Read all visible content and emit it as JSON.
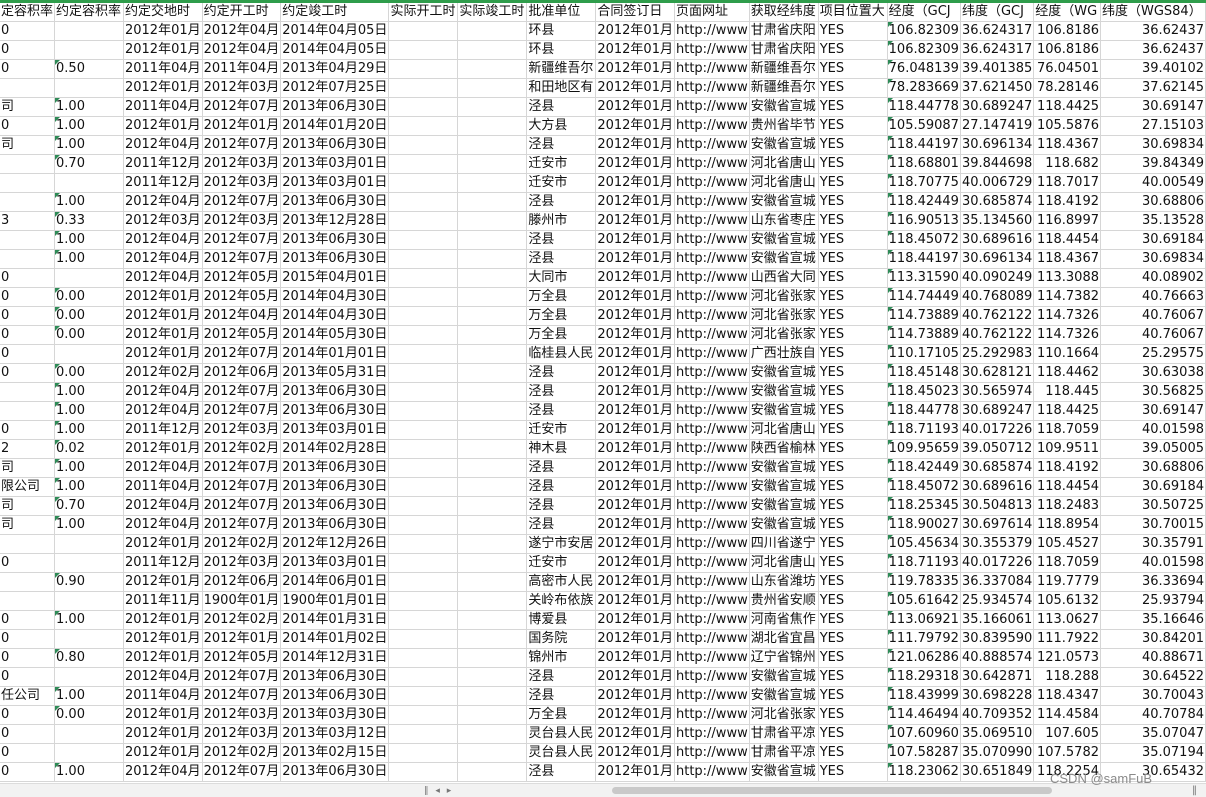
{
  "columns": [
    "定容积率",
    "约定容积率",
    "约定交地时",
    "约定开工时",
    "约定竣工时",
    "实际开工时",
    "实际竣工时",
    "批准单位",
    "合同签订日",
    "页面网址",
    "获取经纬度",
    "项目位置大",
    "经度（GCJ",
    "纬度（GCJ",
    "经度（WG",
    "纬度（WGS84）"
  ],
  "rows": [
    [
      "0",
      "",
      "2012年01月",
      "2012年04月",
      "2014年04月05日",
      "",
      "",
      "环县",
      "2012年01月",
      "http://www",
      "甘肃省庆阳",
      "YES",
      "106.82309",
      "36.624317",
      "106.8186",
      "36.62437"
    ],
    [
      "0",
      "",
      "2012年01月",
      "2012年04月",
      "2014年04月05日",
      "",
      "",
      "环县",
      "2012年01月",
      "http://www",
      "甘肃省庆阳",
      "YES",
      "106.82309",
      "36.624317",
      "106.8186",
      "36.62437"
    ],
    [
      "0",
      "0.50",
      "2011年04月",
      "2011年04月",
      "2013年04月29日",
      "",
      "",
      "新疆维吾尔",
      "2012年01月",
      "http://www",
      "新疆维吾尔",
      "YES",
      "76.048139",
      "39.401385",
      "76.04501",
      "39.40102"
    ],
    [
      "",
      "",
      "2012年01月",
      "2012年03月",
      "2012年07月25日",
      "",
      "",
      "和田地区有",
      "2012年01月",
      "http://www",
      "新疆维吾尔",
      "YES",
      "78.283669",
      "37.621450",
      "78.28146",
      "37.62145"
    ],
    [
      "司",
      "1.00",
      "2011年04月",
      "2012年07月",
      "2013年06月30日",
      "",
      "",
      "泾县",
      "2012年01月",
      "http://www",
      "安徽省宣城",
      "YES",
      "118.44778",
      "30.689247",
      "118.4425",
      "30.69147"
    ],
    [
      "0",
      "1.00",
      "2012年01月",
      "2012年01月",
      "2014年01月20日",
      "",
      "",
      "大方县",
      "2012年01月",
      "http://www",
      "贵州省毕节",
      "YES",
      "105.59087",
      "27.147419",
      "105.5876",
      "27.15103"
    ],
    [
      "司",
      "1.00",
      "2012年04月",
      "2012年07月",
      "2013年06月30日",
      "",
      "",
      "泾县",
      "2012年01月",
      "http://www",
      "安徽省宣城",
      "YES",
      "118.44197",
      "30.696134",
      "118.4367",
      "30.69834"
    ],
    [
      "",
      "0.70",
      "2011年12月",
      "2012年03月",
      "2013年03月01日",
      "",
      "",
      "迁安市",
      "2012年01月",
      "http://www",
      "河北省唐山",
      "YES",
      "118.68801",
      "39.844698",
      "118.682",
      "39.84349"
    ],
    [
      "",
      "",
      "2011年12月",
      "2012年03月",
      "2013年03月01日",
      "",
      "",
      "迁安市",
      "2012年01月",
      "http://www",
      "河北省唐山",
      "YES",
      "118.70775",
      "40.006729",
      "118.7017",
      "40.00549"
    ],
    [
      "",
      "1.00",
      "2012年04月",
      "2012年07月",
      "2013年06月30日",
      "",
      "",
      "泾县",
      "2012年01月",
      "http://www",
      "安徽省宣城",
      "YES",
      "118.42449",
      "30.685874",
      "118.4192",
      "30.68806"
    ],
    [
      "3",
      "0.33",
      "2012年03月",
      "2012年03月",
      "2013年12月28日",
      "",
      "",
      "滕州市",
      "2012年01月",
      "http://www",
      "山东省枣庄",
      "YES",
      "116.90513",
      "35.134560",
      "116.8997",
      "35.13528"
    ],
    [
      "",
      "1.00",
      "2012年04月",
      "2012年07月",
      "2013年06月30日",
      "",
      "",
      "泾县",
      "2012年01月",
      "http://www",
      "安徽省宣城",
      "YES",
      "118.45072",
      "30.689616",
      "118.4454",
      "30.69184"
    ],
    [
      "",
      "1.00",
      "2012年04月",
      "2012年07月",
      "2013年06月30日",
      "",
      "",
      "泾县",
      "2012年01月",
      "http://www",
      "安徽省宣城",
      "YES",
      "118.44197",
      "30.696134",
      "118.4367",
      "30.69834"
    ],
    [
      "0",
      "",
      "2012年04月",
      "2012年05月",
      "2015年04月01日",
      "",
      "",
      "大同市",
      "2012年01月",
      "http://www",
      "山西省大同",
      "YES",
      "113.31590",
      "40.090249",
      "113.3088",
      "40.08902"
    ],
    [
      "0",
      "0.00",
      "2012年01月",
      "2012年05月",
      "2014年04月30日",
      "",
      "",
      "万全县",
      "2012年01月",
      "http://www",
      "河北省张家",
      "YES",
      "114.74449",
      "40.768089",
      "114.7382",
      "40.76663"
    ],
    [
      "0",
      "0.00",
      "2012年01月",
      "2012年04月",
      "2014年04月30日",
      "",
      "",
      "万全县",
      "2012年01月",
      "http://www",
      "河北省张家",
      "YES",
      "114.73889",
      "40.762122",
      "114.7326",
      "40.76067"
    ],
    [
      "0",
      "0.00",
      "2012年01月",
      "2012年05月",
      "2014年05月30日",
      "",
      "",
      "万全县",
      "2012年01月",
      "http://www",
      "河北省张家",
      "YES",
      "114.73889",
      "40.762122",
      "114.7326",
      "40.76067"
    ],
    [
      "0",
      "",
      "2012年01月",
      "2012年07月",
      "2014年01月01日",
      "",
      "",
      "临桂县人民",
      "2012年01月",
      "http://www",
      "广西壮族自",
      "YES",
      "110.17105",
      "25.292983",
      "110.1664",
      "25.29575"
    ],
    [
      "0",
      "0.00",
      "2012年02月",
      "2012年06月",
      "2013年05月31日",
      "",
      "",
      "泾县",
      "2012年01月",
      "http://www",
      "安徽省宣城",
      "YES",
      "118.45148",
      "30.628121",
      "118.4462",
      "30.63038"
    ],
    [
      "",
      "1.00",
      "2012年04月",
      "2012年07月",
      "2013年06月30日",
      "",
      "",
      "泾县",
      "2012年01月",
      "http://www",
      "安徽省宣城",
      "YES",
      "118.45023",
      "30.565974",
      "118.445",
      "30.56825"
    ],
    [
      "",
      "1.00",
      "2012年04月",
      "2012年07月",
      "2013年06月30日",
      "",
      "",
      "泾县",
      "2012年01月",
      "http://www",
      "安徽省宣城",
      "YES",
      "118.44778",
      "30.689247",
      "118.4425",
      "30.69147"
    ],
    [
      "0",
      "1.00",
      "2011年12月",
      "2012年03月",
      "2013年03月01日",
      "",
      "",
      "迁安市",
      "2012年01月",
      "http://www",
      "河北省唐山",
      "YES",
      "118.71193",
      "40.017226",
      "118.7059",
      "40.01598"
    ],
    [
      "2",
      "0.02",
      "2012年01月",
      "2012年02月",
      "2014年02月28日",
      "",
      "",
      "神木县",
      "2012年01月",
      "http://www",
      "陕西省榆林",
      "YES",
      "109.95659",
      "39.050712",
      "109.9511",
      "39.05005"
    ],
    [
      "司",
      "1.00",
      "2012年04月",
      "2012年07月",
      "2013年06月30日",
      "",
      "",
      "泾县",
      "2012年01月",
      "http://www",
      "安徽省宣城",
      "YES",
      "118.42449",
      "30.685874",
      "118.4192",
      "30.68806"
    ],
    [
      "限公司",
      "1.00",
      "2011年04月",
      "2012年07月",
      "2013年06月30日",
      "",
      "",
      "泾县",
      "2012年01月",
      "http://www",
      "安徽省宣城",
      "YES",
      "118.45072",
      "30.689616",
      "118.4454",
      "30.69184"
    ],
    [
      "司",
      "0.70",
      "2012年04月",
      "2012年07月",
      "2013年06月30日",
      "",
      "",
      "泾县",
      "2012年01月",
      "http://www",
      "安徽省宣城",
      "YES",
      "118.25345",
      "30.504813",
      "118.2483",
      "30.50725"
    ],
    [
      "司",
      "1.00",
      "2012年04月",
      "2012年07月",
      "2013年06月30日",
      "",
      "",
      "泾县",
      "2012年01月",
      "http://www",
      "安徽省宣城",
      "YES",
      "118.90027",
      "30.697614",
      "118.8954",
      "30.70015"
    ],
    [
      "",
      "",
      "2012年01月",
      "2012年02月",
      "2012年12月26日",
      "",
      "",
      "遂宁市安居",
      "2012年01月",
      "http://www",
      "四川省遂宁",
      "YES",
      "105.45634",
      "30.355379",
      "105.4527",
      "30.35791"
    ],
    [
      "0",
      "",
      "2011年12月",
      "2012年03月",
      "2013年03月01日",
      "",
      "",
      "迁安市",
      "2012年01月",
      "http://www",
      "河北省唐山",
      "YES",
      "118.71193",
      "40.017226",
      "118.7059",
      "40.01598"
    ],
    [
      "",
      "0.90",
      "2012年01月",
      "2012年06月",
      "2014年06月01日",
      "",
      "",
      "高密市人民",
      "2012年01月",
      "http://www",
      "山东省潍坊",
      "YES",
      "119.78335",
      "36.337084",
      "119.7779",
      "36.33694"
    ],
    [
      "",
      "",
      "2011年11月",
      "1900年01月",
      "1900年01月01日",
      "",
      "",
      "关岭布依族",
      "2012年01月",
      "http://www",
      "贵州省安顺",
      "YES",
      "105.61642",
      "25.934574",
      "105.6132",
      "25.93794"
    ],
    [
      "0",
      "1.00",
      "2012年01月",
      "2012年02月",
      "2014年01月31日",
      "",
      "",
      "博爱县",
      "2012年01月",
      "http://www",
      "河南省焦作",
      "YES",
      "113.06921",
      "35.166061",
      "113.0627",
      "35.16646"
    ],
    [
      "0",
      "",
      "2012年01月",
      "2012年01月",
      "2014年01月02日",
      "",
      "",
      "国务院",
      "2012年01月",
      "http://www",
      "湖北省宜昌",
      "YES",
      "111.79792",
      "30.839590",
      "111.7922",
      "30.84201"
    ],
    [
      "0",
      "0.80",
      "2012年01月",
      "2012年05月",
      "2014年12月31日",
      "",
      "",
      "锦州市",
      "2012年01月",
      "http://www",
      "辽宁省锦州",
      "YES",
      "121.06286",
      "40.888574",
      "121.0573",
      "40.88671"
    ],
    [
      "0",
      "",
      "2012年04月",
      "2012年07月",
      "2013年06月30日",
      "",
      "",
      "泾县",
      "2012年01月",
      "http://www",
      "安徽省宣城",
      "YES",
      "118.29318",
      "30.642871",
      "118.288",
      "30.64522"
    ],
    [
      "任公司",
      "1.00",
      "2011年04月",
      "2012年07月",
      "2013年06月30日",
      "",
      "",
      "泾县",
      "2012年01月",
      "http://www",
      "安徽省宣城",
      "YES",
      "118.43999",
      "30.698228",
      "118.4347",
      "30.70043"
    ],
    [
      "0",
      "0.00",
      "2012年01月",
      "2012年03月",
      "2013年03月30日",
      "",
      "",
      "万全县",
      "2012年01月",
      "http://www",
      "河北省张家",
      "YES",
      "114.46494",
      "40.709352",
      "114.4584",
      "40.70784"
    ],
    [
      "0",
      "",
      "2012年01月",
      "2012年03月",
      "2013年03月12日",
      "",
      "",
      "灵台县人民",
      "2012年01月",
      "http://www",
      "甘肃省平凉",
      "YES",
      "107.60960",
      "35.069510",
      "107.605",
      "35.07047"
    ],
    [
      "0",
      "",
      "2012年01月",
      "2012年02月",
      "2013年02月15日",
      "",
      "",
      "灵台县人民",
      "2012年01月",
      "http://www",
      "甘肃省平凉",
      "YES",
      "107.58287",
      "35.070990",
      "107.5782",
      "35.07194"
    ],
    [
      "0",
      "1.00",
      "2012年04月",
      "2012年07月",
      "2013年06月30日",
      "",
      "",
      "泾县",
      "2012年01月",
      "http://www",
      "安徽省宣城",
      "YES",
      "118.23062",
      "30.651849",
      "118.2254",
      "30.65432"
    ]
  ],
  "scrollbar": {
    "buttons": "‖ ◂ ▸"
  },
  "watermark": "CSDN @samFuB"
}
